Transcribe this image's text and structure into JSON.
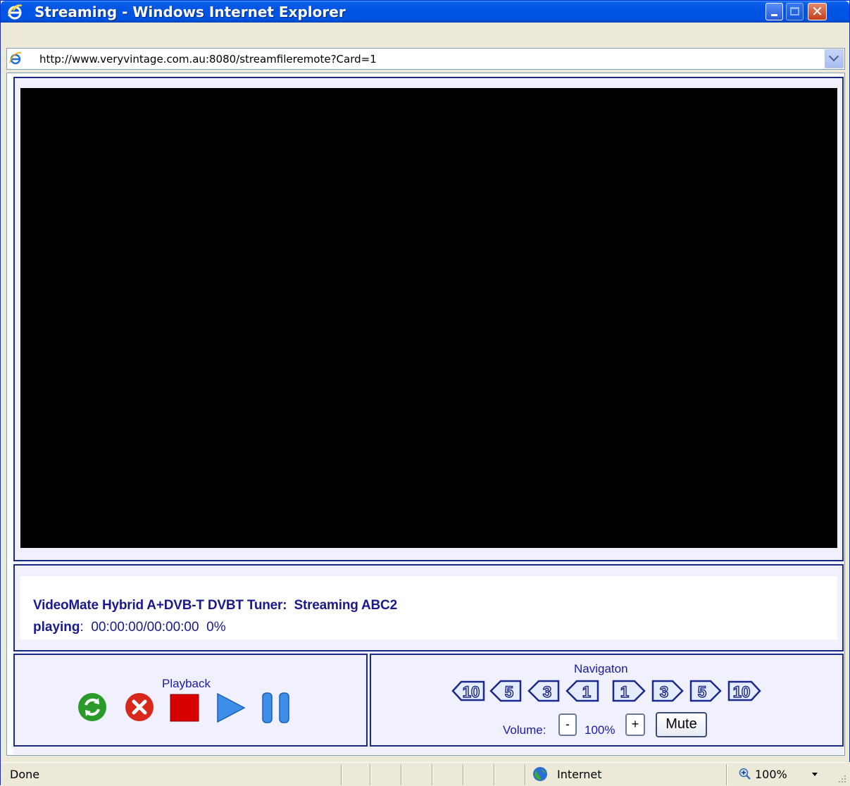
{
  "window": {
    "title": "Streaming - Windows Internet Explorer"
  },
  "address": {
    "url": "http://www.veryvintage.com.au:8080/streamfileremote?Card=1"
  },
  "info": {
    "tuner_label": "VideoMate Hybrid A+DVB-T DVBT Tuner:",
    "stream_label": "Streaming ABC2",
    "status_label": "playing",
    "status_sep": ":",
    "time": "00:00:00/00:00:00",
    "percent": "0%"
  },
  "playback": {
    "title": "Playback",
    "buttons": [
      "refresh",
      "close",
      "stop",
      "play",
      "pause"
    ]
  },
  "navigation": {
    "title": "Navigaton",
    "buttons": [
      {
        "label": "10",
        "dir": "back"
      },
      {
        "label": "5",
        "dir": "back"
      },
      {
        "label": "3",
        "dir": "back"
      },
      {
        "label": "1",
        "dir": "back"
      },
      {
        "label": "1",
        "dir": "forward"
      },
      {
        "label": "3",
        "dir": "forward"
      },
      {
        "label": "5",
        "dir": "forward"
      },
      {
        "label": "10",
        "dir": "forward"
      }
    ],
    "volume_label": "Volume:",
    "volume_minus": "-",
    "volume_value": "100%",
    "volume_plus": "+",
    "mute_label": "Mute"
  },
  "statusbar": {
    "status": "Done",
    "zone": "Internet",
    "zoom": "100%"
  },
  "colors": {
    "title_bar": "#0054e3",
    "frame_border": "#1a2a8a",
    "panel_bg": "#f0f0ff",
    "text_blue": "#1a1a8a"
  }
}
